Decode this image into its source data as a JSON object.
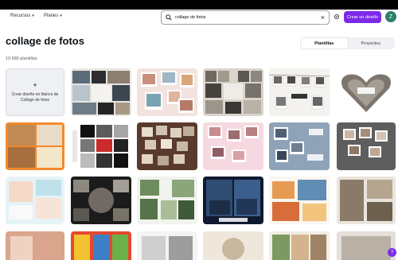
{
  "header": {
    "nav": [
      {
        "label": "Recursos",
        "name": "nav-recursos"
      },
      {
        "label": "Planes",
        "name": "nav-planes"
      }
    ],
    "search": {
      "value": "collage de fotos"
    },
    "create_label": "Crear un diseño",
    "avatar_initial": "Z"
  },
  "main": {
    "title": "collage de fotos",
    "count": "10.689 plantillas",
    "tabs": [
      {
        "label": "Plantillas",
        "active": true
      },
      {
        "label": "Proyectos",
        "active": false
      }
    ],
    "blank_card": {
      "plus": "+",
      "text": "Crear diseño en blanco de Collage de fotos"
    }
  },
  "help_label": "?",
  "colors": {
    "brand_purple": "#7d2ae8",
    "avatar_green": "#2e7d6a",
    "top_bar": "#000000"
  },
  "icons": [
    "search-icon",
    "close-icon",
    "gear-icon",
    "chevron-down-icon",
    "plus-icon"
  ]
}
